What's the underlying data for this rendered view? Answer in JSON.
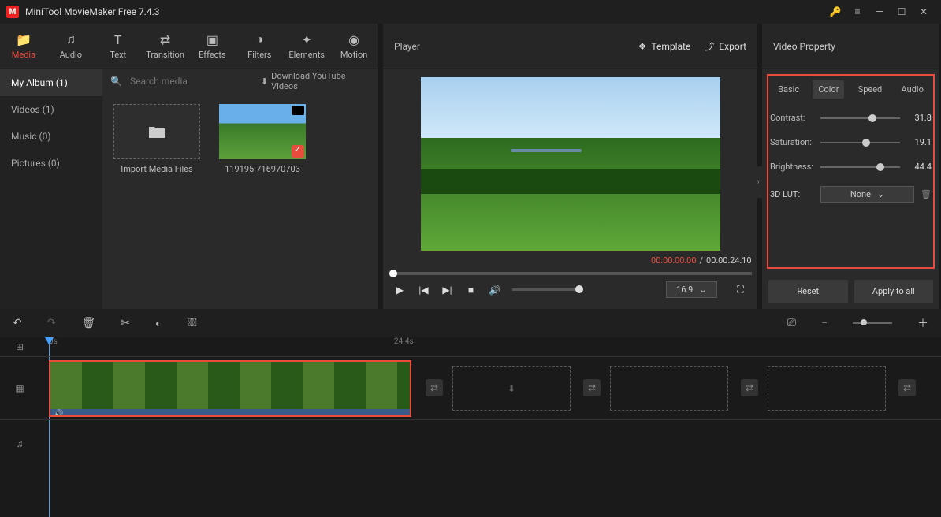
{
  "title": "MiniTool MovieMaker Free 7.4.3",
  "toolbar": [
    {
      "label": "Media",
      "icon": "folder",
      "active": true
    },
    {
      "label": "Audio",
      "icon": "music"
    },
    {
      "label": "Text",
      "icon": "text"
    },
    {
      "label": "Transition",
      "icon": "transition"
    },
    {
      "label": "Effects",
      "icon": "effects"
    },
    {
      "label": "Filters",
      "icon": "filters"
    },
    {
      "label": "Elements",
      "icon": "elements"
    },
    {
      "label": "Motion",
      "icon": "motion"
    }
  ],
  "sidebar": [
    {
      "label": "My Album (1)",
      "active": true
    },
    {
      "label": "Videos (1)"
    },
    {
      "label": "Music (0)"
    },
    {
      "label": "Pictures (0)"
    }
  ],
  "search_placeholder": "Search media",
  "download_label": "Download YouTube Videos",
  "import_label": "Import Media Files",
  "thumb_name": "119195-716970703",
  "player": {
    "title": "Player",
    "template": "Template",
    "export": "Export"
  },
  "timecode": {
    "current": "00:00:00:00",
    "separator": "/",
    "total": "00:00:24:10"
  },
  "aspect": "16:9",
  "property": {
    "title": "Video Property",
    "tabs": [
      "Basic",
      "Color",
      "Speed",
      "Audio"
    ],
    "active_tab": "Color",
    "rows": [
      {
        "label": "Contrast:",
        "value": "31.8",
        "pos": 60
      },
      {
        "label": "Saturation:",
        "value": "19.1",
        "pos": 52
      },
      {
        "label": "Brightness:",
        "value": "44.4",
        "pos": 70
      }
    ],
    "lut": {
      "label": "3D LUT:",
      "value": "None"
    },
    "reset": "Reset",
    "apply": "Apply to all"
  },
  "ruler": {
    "t0": "0s",
    "t1": "24.4s"
  }
}
